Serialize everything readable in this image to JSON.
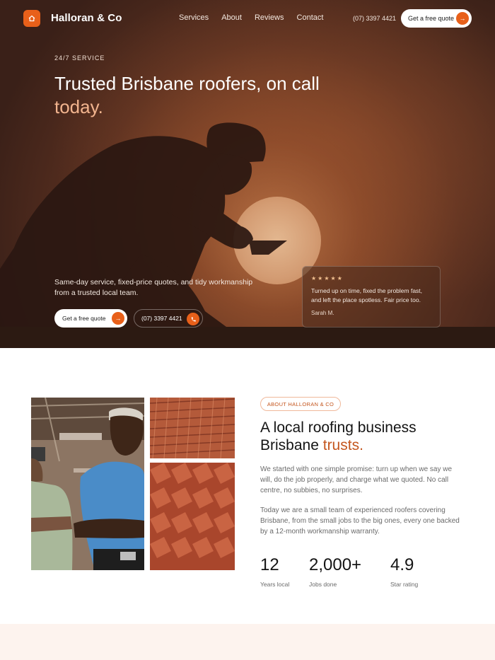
{
  "nav": {
    "brand": "Halloran & Co",
    "links": [
      "Services",
      "About",
      "Reviews",
      "Contact"
    ],
    "phone": "(07) 3397 4421",
    "cta": "Get a free quote"
  },
  "hero": {
    "eyebrow": "24/7 SERVICE",
    "title_main": "Trusted Brisbane roofers, on call",
    "title_accent": "today.",
    "subtitle": "Same-day service, fixed-price quotes, and tidy workmanship from a trusted local team.",
    "cta_quote": "Get a free quote",
    "cta_phone": "(07) 3397 4421",
    "review": {
      "stars": "★★★★★",
      "text": "Turned up on time, fixed the problem fast, and left the place spotless. Fair price too.",
      "author": "Sarah M."
    }
  },
  "about": {
    "pill": "ABOUT HALLORAN & CO",
    "title_main": "A local roofing business Brisbane",
    "title_accent": "trusts.",
    "paragraph1": "We started with one simple promise: turn up when we say we will, do the job properly, and charge what we quoted. No call centre, no subbies, no surprises.",
    "paragraph2": "Today we are a small team of experienced roofers covering Brisbane, from the small jobs to the big ones, every one backed by a 12-month workmanship warranty.",
    "stats": [
      {
        "value": "12",
        "label": "Years local"
      },
      {
        "value": "2,000+",
        "label": "Jobs done"
      },
      {
        "value": "4.9",
        "label": "Star rating"
      }
    ]
  },
  "colors": {
    "accent": "#e8601a",
    "accent_text": "#c4561e",
    "hero_accent": "#f2b48e",
    "bottom_band": "#fdf3ee"
  },
  "icons": {
    "logo": "home-icon",
    "arrow": "arrow-right-icon",
    "phone": "phone-icon"
  }
}
